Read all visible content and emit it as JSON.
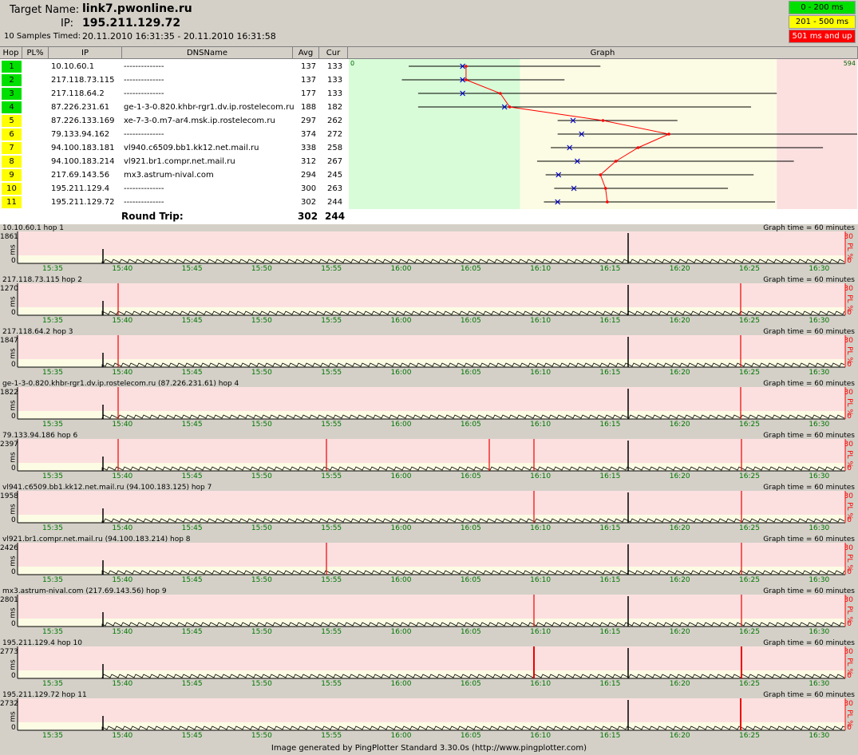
{
  "header": {
    "target_label": "Target Name:",
    "target_value": "link7.pwonline.ru",
    "ip_label": "IP:",
    "ip_value": "195.211.129.72",
    "samples_label": "10 Samples Timed:",
    "samples_value": "20.11.2010 16:31:35 - 20.11.2010 16:31:58"
  },
  "legend": [
    {
      "label": "0 - 200 ms",
      "color": "#00e000",
      "text_color": "#000"
    },
    {
      "label": "201 - 500 ms",
      "color": "#ffff00",
      "text_color": "#000"
    },
    {
      "label": "501 ms and up",
      "color": "#ff0000",
      "text_color": "#fff"
    }
  ],
  "columns": {
    "hop": "Hop",
    "pl": "PL%",
    "ip": "IP",
    "dns": "DNSName",
    "avg": "Avg",
    "cur": "Cur",
    "graph": "Graph"
  },
  "graph_scale": {
    "min": "0",
    "max": "594"
  },
  "hops": [
    {
      "hop": "1",
      "ip": "10.10.60.1",
      "dns": "--------------",
      "avg": "137",
      "cur": "133",
      "color": "green",
      "min": 70,
      "max": 294
    },
    {
      "hop": "2",
      "ip": "217.118.73.115",
      "dns": "--------------",
      "avg": "137",
      "cur": "133",
      "color": "green",
      "min": 62,
      "max": 252
    },
    {
      "hop": "3",
      "ip": "217.118.64.2",
      "dns": "--------------",
      "avg": "177",
      "cur": "133",
      "color": "green",
      "min": 81,
      "max": 500
    },
    {
      "hop": "4",
      "ip": "87.226.231.61",
      "dns": "ge-1-3-0.820.khbr-rgr1.dv.ip.rostelecom.ru",
      "avg": "188",
      "cur": "182",
      "color": "green",
      "min": 81,
      "max": 470
    },
    {
      "hop": "5",
      "ip": "87.226.133.169",
      "dns": "xe-7-3-0.m7-ar4.msk.ip.rostelecom.ru",
      "avg": "297",
      "cur": "262",
      "color": "yellow",
      "min": 244,
      "max": 384
    },
    {
      "hop": "6",
      "ip": "79.133.94.162",
      "dns": "--------------",
      "avg": "374",
      "cur": "272",
      "color": "yellow",
      "min": 244,
      "max": 594
    },
    {
      "hop": "7",
      "ip": "94.100.183.181",
      "dns": "vl940.c6509.bb1.kk12.net.mail.ru",
      "avg": "338",
      "cur": "258",
      "color": "yellow",
      "min": 236,
      "max": 554
    },
    {
      "hop": "8",
      "ip": "94.100.183.214",
      "dns": "vl921.br1.compr.net.mail.ru",
      "avg": "312",
      "cur": "267",
      "color": "yellow",
      "min": 220,
      "max": 520
    },
    {
      "hop": "9",
      "ip": "217.69.143.56",
      "dns": "mx3.astrum-nival.com",
      "avg": "294",
      "cur": "245",
      "color": "yellow",
      "min": 230,
      "max": 473
    },
    {
      "hop": "10",
      "ip": "195.211.129.4",
      "dns": "--------------",
      "avg": "300",
      "cur": "263",
      "color": "yellow",
      "min": 240,
      "max": 443
    },
    {
      "hop": "11",
      "ip": "195.211.129.72",
      "dns": "--------------",
      "avg": "302",
      "cur": "244",
      "color": "yellow",
      "min": 228,
      "max": 498
    }
  ],
  "round_trip": {
    "label": "Round Trip:",
    "avg": "302",
    "cur": "244"
  },
  "time_labels": [
    "15:35",
    "15:40",
    "15:45",
    "15:50",
    "15:55",
    "16:00",
    "16:05",
    "16:10",
    "16:15",
    "16:20",
    "16:25",
    "16:30"
  ],
  "graph_time": "Graph time = 60 minutes",
  "axis": {
    "ms": "ms",
    "zero": "0",
    "pl_max": "30",
    "pl_label": "PL %",
    "pl_zero": "0"
  },
  "charts": [
    {
      "title": "10.10.60.1 hop 1",
      "max": "1861"
    },
    {
      "title": "217.118.73.115 hop 2",
      "max": "1270"
    },
    {
      "title": "217.118.64.2 hop 3",
      "max": "1847"
    },
    {
      "title": "ge-1-3-0.820.khbr-rgr1.dv.ip.rostelecom.ru (87.226.231.61) hop 4",
      "max": "1822"
    },
    {
      "title": "79.133.94.186 hop 6",
      "max": "2397"
    },
    {
      "title": "vl941.c6509.bb1.kk12.net.mail.ru (94.100.183.125) hop 7",
      "max": "1958"
    },
    {
      "title": "vl921.br1.compr.net.mail.ru (94.100.183.214) hop 8",
      "max": "2426"
    },
    {
      "title": "mx3.astrum-nival.com (217.69.143.56) hop 9",
      "max": "2801"
    },
    {
      "title": "195.211.129.4 hop 10",
      "max": "2773"
    },
    {
      "title": "195.211.129.72 hop 11",
      "max": "2732"
    }
  ],
  "footer": "Image generated by PingPlotter Standard 3.30.0s (http://www.pingplotter.com)"
}
